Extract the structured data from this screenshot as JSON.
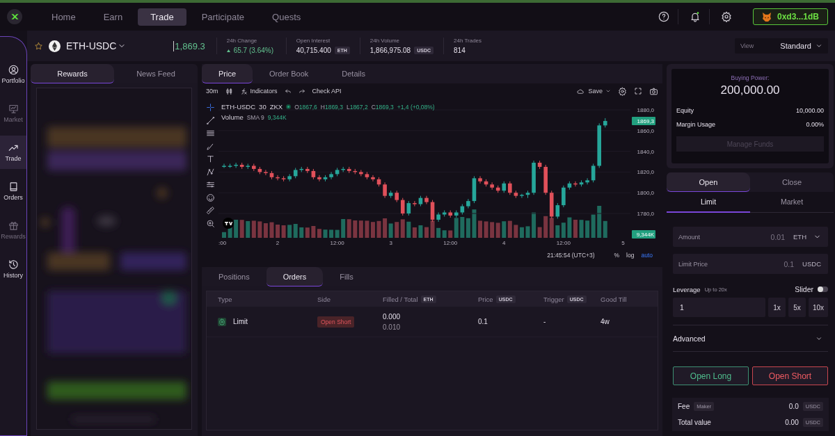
{
  "top_nav": {
    "items": [
      {
        "label": "Home",
        "selected": false
      },
      {
        "label": "Earn",
        "selected": false
      },
      {
        "label": "Trade",
        "selected": true
      },
      {
        "label": "Participate",
        "selected": false
      },
      {
        "label": "Quests",
        "selected": false
      }
    ],
    "wallet": {
      "address": "0xd3...1dB"
    }
  },
  "sidebar": {
    "items": [
      {
        "label": "Portfolio",
        "selected": false,
        "disabled": false
      },
      {
        "label": "Market",
        "selected": false,
        "disabled": true
      },
      {
        "label": "Trade",
        "selected": true,
        "disabled": false
      },
      {
        "label": "Orders",
        "selected": false,
        "disabled": false
      },
      {
        "label": "Rewards",
        "selected": false,
        "disabled": true
      },
      {
        "label": "History",
        "selected": false,
        "disabled": false
      }
    ]
  },
  "market": {
    "symbol": "ETH-USDC",
    "price": "1,869.3",
    "stats": [
      {
        "label": "24h Change",
        "value": "65.7 (3.64%)",
        "kind": "up"
      },
      {
        "label": "Open Interest",
        "value": "40,715.400",
        "unit": "ETH",
        "kind": "plain"
      },
      {
        "label": "24h Volume",
        "value": "1,866,975.08",
        "unit": "USDC",
        "kind": "plain"
      },
      {
        "label": "24h Trades",
        "value": "814",
        "kind": "plain"
      }
    ],
    "view": {
      "label": "View",
      "value": "Standard"
    }
  },
  "left_panel": {
    "tabs": [
      {
        "label": "Rewards",
        "selected": true
      },
      {
        "label": "News Feed",
        "selected": false
      }
    ]
  },
  "chart_panel": {
    "tabs": [
      {
        "label": "Price",
        "selected": true
      },
      {
        "label": "Order Book",
        "selected": false
      },
      {
        "label": "Details",
        "selected": false
      }
    ],
    "toolbar": {
      "interval": "30m",
      "indicators": "Indicators",
      "check_api": "Check API",
      "save": "Save"
    },
    "legend": {
      "symbol": "ETH-USDC",
      "interval": "30",
      "exchange": "ZKX",
      "ohlc": [
        {
          "key": "O",
          "value": "1867,6"
        },
        {
          "key": "H",
          "value": "1869,3"
        },
        {
          "key": "L",
          "value": "1867,2"
        },
        {
          "key": "C",
          "value": "1869,3"
        }
      ],
      "change": "+1,4 (+0,08%)",
      "volume_label": "Volume",
      "volume_sma": "SMA 9",
      "volume_value": "9,344K"
    },
    "price_tag": "1869,3",
    "volume_tag": "9,344K",
    "time": "21:45:54 (UTC+3)",
    "scale_options": [
      {
        "label": "%",
        "selected": false
      },
      {
        "label": "log",
        "selected": false
      },
      {
        "label": "auto",
        "selected": true
      }
    ],
    "chart_data": {
      "type": "candlestick",
      "categories": [
        ":00",
        null,
        null,
        null,
        null,
        null,
        null,
        null,
        null,
        "2",
        null,
        null,
        null,
        null,
        null,
        null,
        null,
        null,
        null,
        "12:00",
        null,
        null,
        null,
        null,
        null,
        null,
        null,
        null,
        "3",
        null,
        null,
        null,
        null,
        null,
        null,
        null,
        null,
        null,
        "12:00",
        null,
        null,
        null,
        null,
        null,
        null,
        null,
        null,
        "4",
        null,
        null,
        null,
        null,
        null,
        null,
        null,
        null,
        null,
        "12:00",
        null,
        null,
        null,
        null,
        null,
        null,
        null,
        null,
        null,
        "5"
      ],
      "ohlc": [
        [
          1826,
          1828,
          1824,
          1826
        ],
        [
          1826,
          1828,
          1824,
          1826
        ],
        [
          1826,
          1829,
          1824,
          1827
        ],
        [
          1827,
          1829,
          1823,
          1825
        ],
        [
          1825,
          1828,
          1823,
          1826
        ],
        [
          1826,
          1828,
          1821,
          1823
        ],
        [
          1823,
          1825,
          1818,
          1820
        ],
        [
          1820,
          1822,
          1817,
          1819
        ],
        [
          1819,
          1821,
          1813,
          1815
        ],
        [
          1815,
          1817,
          1812,
          1814
        ],
        [
          1814,
          1816,
          1811,
          1813
        ],
        [
          1813,
          1818,
          1811,
          1816
        ],
        [
          1816,
          1824,
          1814,
          1822
        ],
        [
          1822,
          1825,
          1820,
          1823
        ],
        [
          1823,
          1825,
          1819,
          1821
        ],
        [
          1821,
          1823,
          1813,
          1815
        ],
        [
          1815,
          1817,
          1811,
          1813
        ],
        [
          1813,
          1817,
          1811,
          1815
        ],
        [
          1815,
          1820,
          1813,
          1818
        ],
        [
          1818,
          1824,
          1816,
          1822
        ],
        [
          1822,
          1825,
          1820,
          1823
        ],
        [
          1823,
          1825,
          1819,
          1821
        ],
        [
          1821,
          1823,
          1818,
          1820
        ],
        [
          1820,
          1822,
          1816,
          1818
        ],
        [
          1818,
          1820,
          1813,
          1815
        ],
        [
          1815,
          1817,
          1811,
          1813
        ],
        [
          1813,
          1815,
          1806,
          1808
        ],
        [
          1808,
          1810,
          1795,
          1797
        ],
        [
          1797,
          1802,
          1795,
          1800
        ],
        [
          1800,
          1802,
          1791,
          1793
        ],
        [
          1793,
          1795,
          1778,
          1780
        ],
        [
          1780,
          1792,
          1778,
          1790
        ],
        [
          1790,
          1792,
          1787,
          1789
        ],
        [
          1789,
          1797,
          1787,
          1795
        ],
        [
          1795,
          1797,
          1789,
          1791
        ],
        [
          1791,
          1793,
          1772,
          1774
        ],
        [
          1774,
          1781,
          1772,
          1779
        ],
        [
          1779,
          1783,
          1777,
          1781
        ],
        [
          1781,
          1783,
          1776,
          1778
        ],
        [
          1778,
          1783,
          1776,
          1781
        ],
        [
          1781,
          1789,
          1779,
          1787
        ],
        [
          1787,
          1794,
          1785,
          1792
        ],
        [
          1792,
          1816,
          1790,
          1814
        ],
        [
          1814,
          1816,
          1809,
          1811
        ],
        [
          1811,
          1813,
          1806,
          1808
        ],
        [
          1808,
          1810,
          1803,
          1805
        ],
        [
          1805,
          1807,
          1800,
          1802
        ],
        [
          1802,
          1811,
          1800,
          1809
        ],
        [
          1809,
          1811,
          1798,
          1800
        ],
        [
          1800,
          1802,
          1795,
          1797
        ],
        [
          1797,
          1799,
          1795,
          1798
        ],
        [
          1798,
          1802,
          1795,
          1800
        ],
        [
          1800,
          1831,
          1798,
          1829
        ],
        [
          1829,
          1831,
          1823,
          1825
        ],
        [
          1825,
          1827,
          1798,
          1800
        ],
        [
          1800,
          1802,
          1775,
          1777
        ],
        [
          1777,
          1790,
          1775,
          1788
        ],
        [
          1788,
          1807,
          1786,
          1805
        ],
        [
          1805,
          1811,
          1803,
          1809
        ],
        [
          1809,
          1811,
          1806,
          1808
        ],
        [
          1808,
          1812,
          1806,
          1810
        ],
        [
          1810,
          1814,
          1808,
          1812
        ],
        [
          1812,
          1828,
          1810,
          1826
        ],
        [
          1826,
          1867,
          1824,
          1865
        ],
        [
          1865,
          1872,
          1863,
          1869.3
        ],
        null,
        null,
        null
      ],
      "ylim": [
        1780,
        1880
      ],
      "grid": true,
      "yticks": [
        {
          "value": 1780,
          "label": "1780,0"
        },
        {
          "value": 1800,
          "label": "1800,0"
        },
        {
          "value": 1820,
          "label": "1820,0"
        },
        {
          "value": 1840,
          "label": "1840,0"
        },
        {
          "value": 1860,
          "label": "1860,0"
        },
        {
          "value": 1880,
          "label": "1880,0"
        }
      ]
    }
  },
  "orders_panel": {
    "tabs": [
      {
        "label": "Positions",
        "selected": false
      },
      {
        "label": "Orders",
        "selected": true
      },
      {
        "label": "Fills",
        "selected": false
      }
    ],
    "columns": [
      {
        "label": "Type"
      },
      {
        "label": "Side"
      },
      {
        "label": "Filled / Total",
        "unit": "ETH"
      },
      {
        "label": "Price",
        "unit": "USDC"
      },
      {
        "label": "Trigger",
        "unit": "USDC"
      },
      {
        "label": "Good Till"
      }
    ],
    "rows": [
      {
        "type": "Limit",
        "side": "Open Short",
        "filled": "0.000",
        "total": "0.010",
        "price": "0.1",
        "trigger": "-",
        "good_till": "4w"
      }
    ]
  },
  "account": {
    "title": "Buying Power:",
    "value": "200,000.00",
    "rows": [
      {
        "label": "Equity",
        "value": "10,000.00"
      },
      {
        "label": "Margin Usage",
        "value": "0.00%"
      }
    ],
    "button": {
      "label": "Manage Funds",
      "disabled": true
    }
  },
  "order_form": {
    "mode_tabs": [
      {
        "label": "Open",
        "selected": true
      },
      {
        "label": "Close",
        "selected": false
      }
    ],
    "type_tabs": [
      {
        "label": "Limit",
        "selected": true
      },
      {
        "label": "Market",
        "selected": false
      }
    ],
    "fields": [
      {
        "label": "Amount",
        "placeholder": "0.01",
        "unit": "ETH",
        "dropdown": true
      },
      {
        "label": "Limit Price",
        "placeholder": "0.1",
        "unit": "USDC",
        "dropdown": false
      }
    ],
    "leverage": {
      "label": "Leverage",
      "hint": "Up to 20x",
      "value": "1",
      "presets": [
        "1x",
        "5x",
        "10x"
      ],
      "slider": {
        "label": "Slider",
        "on": false
      }
    },
    "advanced": {
      "label": "Advanced",
      "expanded": false
    },
    "buttons": [
      {
        "label": "Open Long",
        "kind": "long"
      },
      {
        "label": "Open Short",
        "kind": "short"
      }
    ],
    "summary": [
      {
        "label": "Fee",
        "badge": "Maker",
        "value": "0.0",
        "unit": "USDC"
      },
      {
        "label": "Total value",
        "value": "0.00",
        "unit": "USDC"
      }
    ]
  }
}
